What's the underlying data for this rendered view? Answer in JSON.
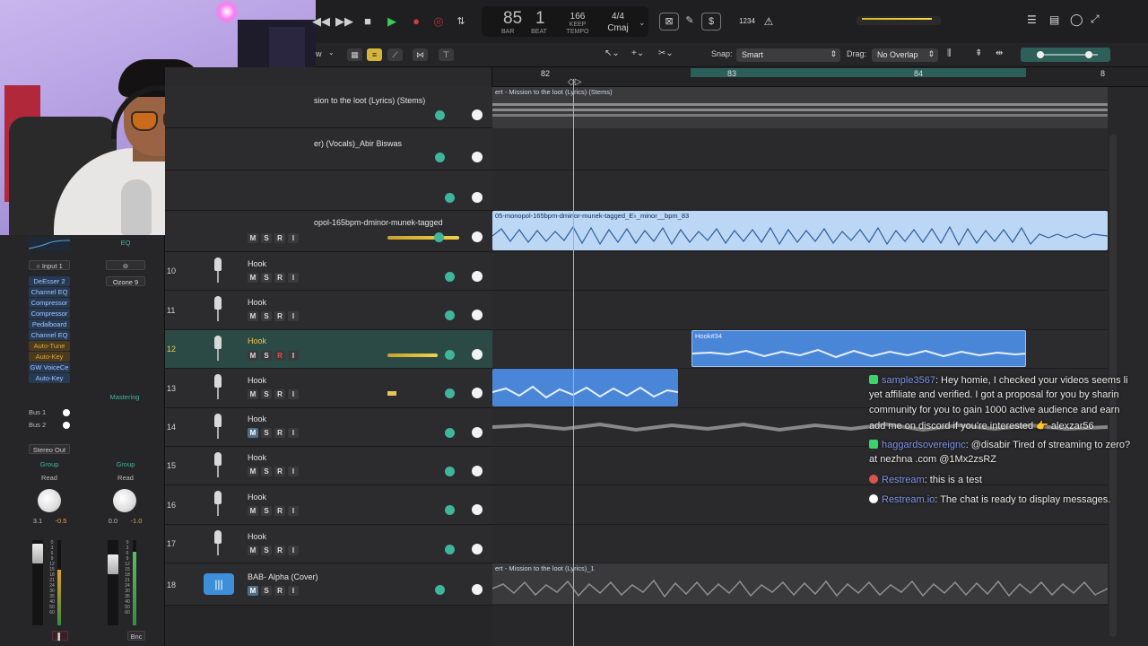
{
  "transport": {
    "bar": "85",
    "beat": "1",
    "bar_label": "BAR",
    "beat_label": "BEAT",
    "tempo": "166",
    "tempo_mode": "KEEP",
    "tempo_label": "TEMPO",
    "time_sig": "4/4",
    "key": "Cmaj",
    "count_in": "1234"
  },
  "toolbar": {
    "snap_label": "Snap:",
    "snap_value": "Smart",
    "drag_label": "Drag:",
    "drag_value": "No Overlap",
    "view_label": "w"
  },
  "ruler": {
    "bars": [
      "82",
      "83",
      "84",
      "8"
    ]
  },
  "inspector": {
    "eq_label": "EQ",
    "input_label": "Input 1",
    "ozone_label": "Ozone 9",
    "plugins": [
      "DeEsser 2",
      "Channel EQ",
      "Compressor",
      "Compressor",
      "Pedalboard",
      "Channel EQ",
      "Auto-Tune",
      "Auto-Key",
      "GW VoiceCe",
      "Auto-Key"
    ],
    "mastering_label": "Mastering",
    "bus1": "Bus 1",
    "bus2": "Bus 2",
    "stereo_out": "Stereo Out",
    "group_left": "Group",
    "group_right": "Group",
    "read_left": "Read",
    "read_right": "Read",
    "pan_left_a": "3.1",
    "pan_left_b": "-0.5",
    "pan_right_a": "0.0",
    "pan_right_b": "-1.0",
    "bnc_label": "Bnc",
    "scale": [
      "0",
      "3",
      "6",
      "9",
      "12",
      "15",
      "18",
      "21",
      "24",
      "30",
      "35",
      "40",
      "50",
      "60"
    ]
  },
  "tracks": [
    {
      "number": "",
      "name": "sion to the loot (Lyrics) (Stems)"
    },
    {
      "number": "",
      "name": "er) (Vocals)_Abir Biswas"
    },
    {
      "number": "",
      "name": ""
    },
    {
      "number": "",
      "name": "opol-165bpm-dminor-munek-tagged"
    },
    {
      "number": "10",
      "name": "Hook"
    },
    {
      "number": "11",
      "name": "Hook"
    },
    {
      "number": "12",
      "name": "Hook"
    },
    {
      "number": "13",
      "name": "Hook"
    },
    {
      "number": "14",
      "name": "Hook"
    },
    {
      "number": "15",
      "name": "Hook"
    },
    {
      "number": "16",
      "name": "Hook"
    },
    {
      "number": "17",
      "name": "Hook"
    },
    {
      "number": "18",
      "name": "BAB- Alpha (Cover)"
    }
  ],
  "msri": {
    "m": "M",
    "s": "S",
    "r": "R",
    "i": "I"
  },
  "regions": {
    "stems": "ert - Mission to the loot (Lyrics) (Stems)",
    "beat": "05-monopol-165bpm-dminor-munek-tagged_E♭_minor__bpm_83",
    "hook34": "Hook#34",
    "alpha": "ert - Mission to the loot (Lyrics)_1"
  },
  "chat": [
    {
      "user": "sample3567",
      "text": ": Hey homie, I checked your videos seems li",
      "badge_color": "#3bd36b"
    },
    {
      "user": "",
      "text": "yet affiliate and verified. I got a proposal for you by sharin",
      "badge_color": ""
    },
    {
      "user": "",
      "text": "community for you to gain 1000 active audience and earn",
      "badge_color": ""
    },
    {
      "user": "",
      "text": "add me on discord if you're interested 👉 alexzar56",
      "badge_color": ""
    },
    {
      "user": "haggardsovereignc",
      "text": ": @disabir Tired of streaming to zero?",
      "badge_color": "#3bd36b"
    },
    {
      "user": "",
      "text": "at nezhna .com @1Mx2zsRZ",
      "badge_color": ""
    },
    {
      "user": "Restream",
      "text": ": this is a test",
      "badge_color": "#d9534f"
    },
    {
      "user": "Restream.io",
      "text": ": The chat is ready to display messages.",
      "badge_color": "#ffffff"
    }
  ],
  "colors": {
    "accent_yellow": "#f1d24a",
    "region_blue": "#bcd6f5",
    "pan_green": "#3fb59b",
    "selected_track": "#2b4a46"
  }
}
